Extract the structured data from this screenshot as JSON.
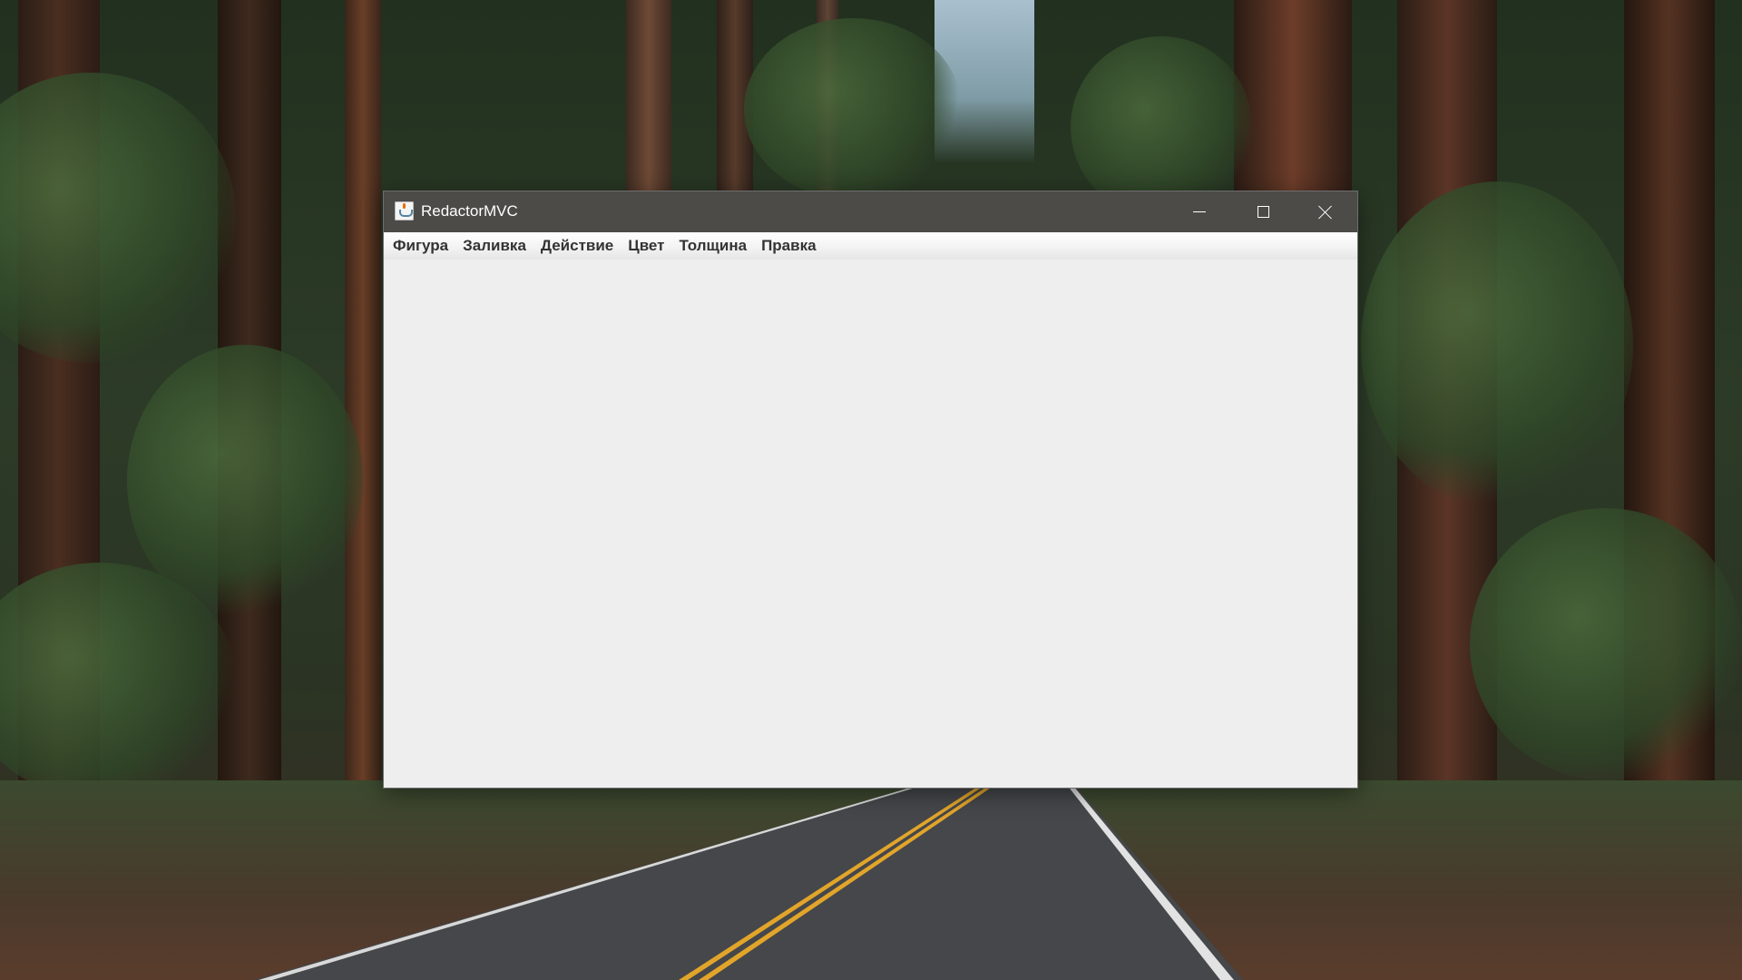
{
  "window": {
    "title": "RedactorMVC",
    "icon": "java-cup-icon",
    "controls": {
      "minimize": "minimize-icon",
      "maximize": "maximize-icon",
      "close": "close-icon"
    }
  },
  "menubar": {
    "items": [
      {
        "label": "Фигура"
      },
      {
        "label": "Заливка"
      },
      {
        "label": "Действие"
      },
      {
        "label": "Цвет"
      },
      {
        "label": "Толщина"
      },
      {
        "label": "Правка"
      }
    ]
  },
  "colors": {
    "titlebar": "#4d4b48",
    "client_area": "#eeeeee",
    "menu_text": "#333333"
  }
}
